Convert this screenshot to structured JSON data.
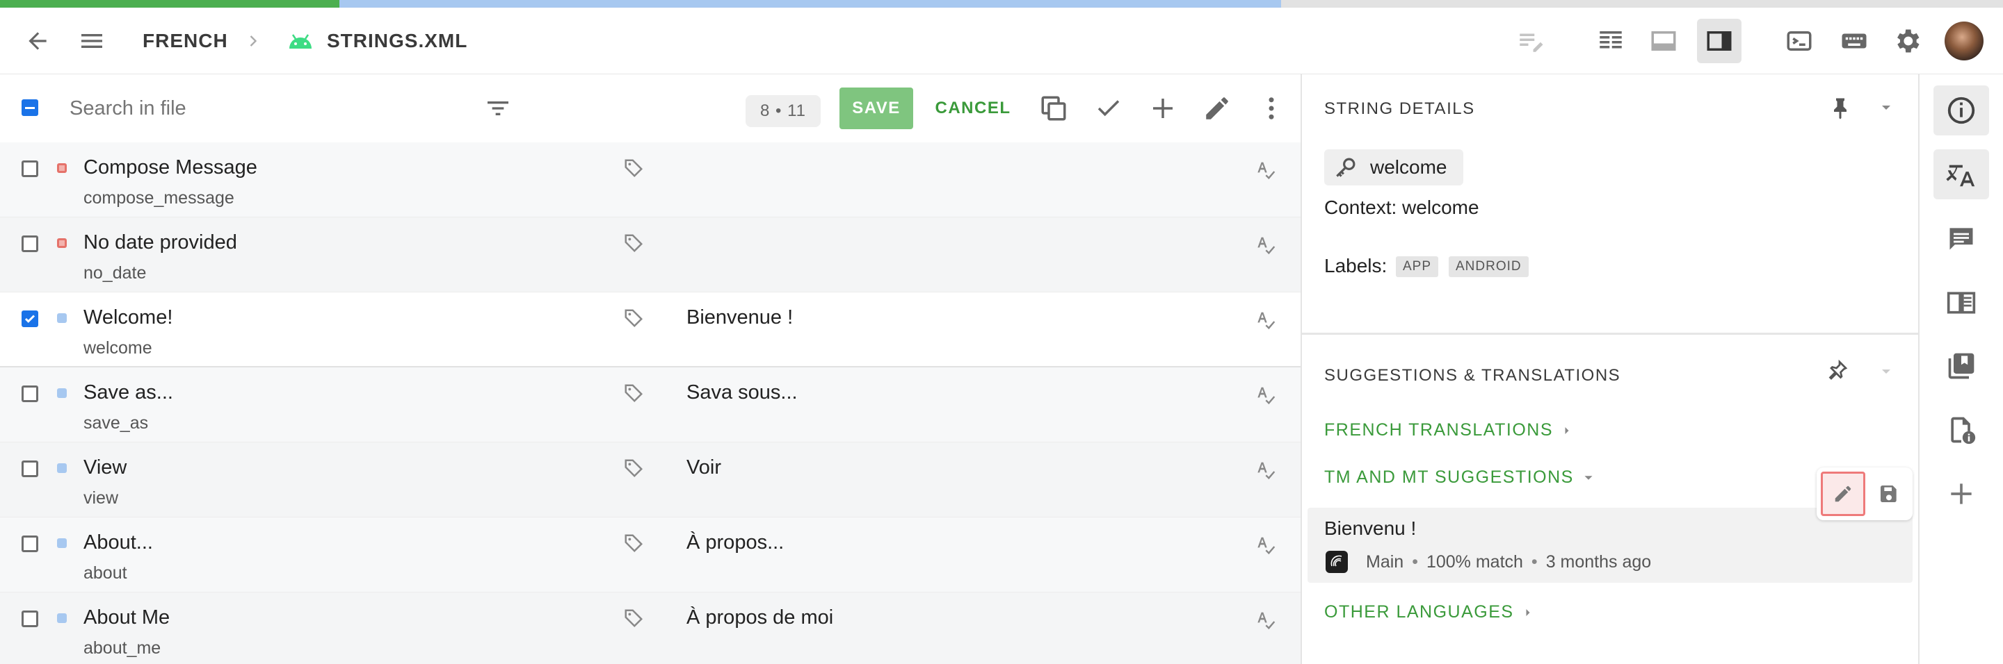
{
  "header": {
    "breadcrumb_language": "FRENCH",
    "breadcrumb_file": "STRINGS.XML"
  },
  "colors": {
    "progress_done": "#4caf50",
    "progress_partial": "#a7c8f0",
    "progress_rest": "#e2e2e2",
    "accent_green": "#4caf50",
    "accent_blue": "#1a73e8"
  },
  "editor": {
    "search_placeholder": "Search in file",
    "counter": "8 • 11",
    "save_label": "SAVE",
    "cancel_label": "CANCEL"
  },
  "strings": [
    {
      "source": "Compose Message",
      "key": "compose_message",
      "translation": "",
      "status": "untranslated",
      "checked": false
    },
    {
      "source": "No date provided",
      "key": "no_date",
      "translation": "",
      "status": "untranslated",
      "checked": false
    },
    {
      "source": "Welcome!",
      "key": "welcome",
      "translation": "Bienvenue !",
      "status": "translated",
      "checked": true
    },
    {
      "source": "Save as...",
      "key": "save_as",
      "translation": "Sava sous...",
      "status": "translated",
      "checked": false
    },
    {
      "source": "View",
      "key": "view",
      "translation": "Voir",
      "status": "translated",
      "checked": false
    },
    {
      "source": "About...",
      "key": "about",
      "translation": "À propos...",
      "status": "translated",
      "checked": false
    },
    {
      "source": "About Me",
      "key": "about_me",
      "translation": "À propos de moi",
      "status": "translated",
      "checked": false
    }
  ],
  "details": {
    "title": "STRING DETAILS",
    "key_name": "welcome",
    "context": "Context: welcome",
    "labels_title": "Labels:",
    "labels": [
      "APP",
      "ANDROID"
    ]
  },
  "suggestions": {
    "title": "SUGGESTIONS & TRANSLATIONS",
    "french_translations": "FRENCH TRANSLATIONS",
    "tm_mt": "TM AND MT SUGGESTIONS",
    "suggestion_text": "Bienvenu !",
    "suggestion_source": "Main",
    "suggestion_match": "100% match",
    "suggestion_age": "3 months ago",
    "other_languages": "OTHER LANGUAGES"
  }
}
